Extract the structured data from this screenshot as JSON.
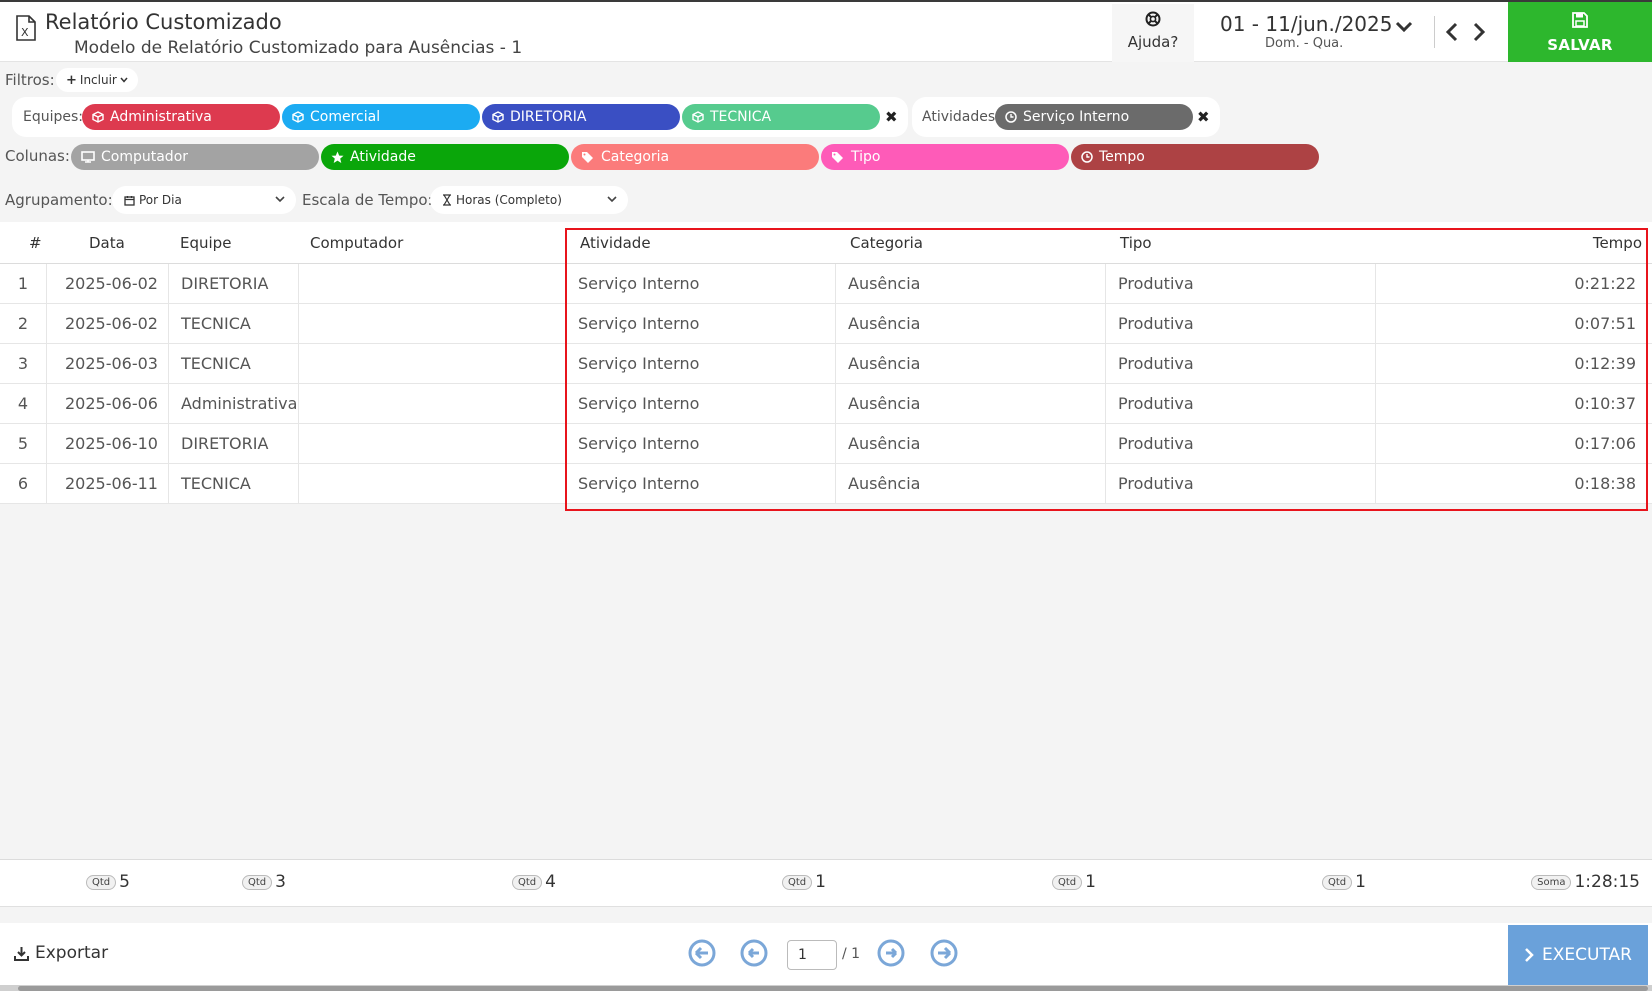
{
  "header": {
    "title": "Relatório Customizado",
    "subtitle": "Modelo de Relatório Customizado para Ausências - 1",
    "help_label": "Ajuda?",
    "date_range": "01 - 11/jun./2025",
    "date_days": "Dom. - Qua.",
    "save_label": "SALVAR"
  },
  "filters": {
    "label": "Filtros:",
    "include_label": "Incluir",
    "teams_label": "Equipes:",
    "teams": [
      {
        "label": "Administrativa",
        "color": "#dd3a4f"
      },
      {
        "label": "Comercial",
        "color": "#1cabf2"
      },
      {
        "label": "DIRETORIA",
        "color": "#3a4fc3"
      },
      {
        "label": "TECNICA",
        "color": "#56cb8e"
      }
    ],
    "activities_label": "Atividades:",
    "activities": [
      {
        "label": "Serviço Interno",
        "color": "#6b6b6b"
      }
    ]
  },
  "columns": {
    "label": "Colunas:",
    "items": [
      {
        "label": "Computador",
        "color": "#a3a3a3"
      },
      {
        "label": "Atividade",
        "color": "#0aa60a"
      },
      {
        "label": "Categoria",
        "color": "#fb7b7b"
      },
      {
        "label": "Tipo",
        "color": "#fe5bb8"
      },
      {
        "label": "Tempo",
        "color": "#ad4244"
      }
    ]
  },
  "grouping": {
    "label": "Agrupamento:",
    "value": "Por Dia",
    "scale_label": "Escala de Tempo:",
    "scale_value": "Horas (Completo)"
  },
  "table": {
    "headers": [
      "#",
      "Data",
      "Equipe",
      "Computador",
      "Atividade",
      "Categoria",
      "Tipo",
      "Tempo"
    ],
    "rows": [
      [
        "1",
        "2025-06-02",
        "DIRETORIA",
        "",
        "Serviço Interno",
        "Ausência",
        "Produtiva",
        "0:21:22"
      ],
      [
        "2",
        "2025-06-02",
        "TECNICA",
        "",
        "Serviço Interno",
        "Ausência",
        "Produtiva",
        "0:07:51"
      ],
      [
        "3",
        "2025-06-03",
        "TECNICA",
        "",
        "Serviço Interno",
        "Ausência",
        "Produtiva",
        "0:12:39"
      ],
      [
        "4",
        "2025-06-06",
        "Administrativa",
        "",
        "Serviço Interno",
        "Ausência",
        "Produtiva",
        "0:10:37"
      ],
      [
        "5",
        "2025-06-10",
        "DIRETORIA",
        "",
        "Serviço Interno",
        "Ausência",
        "Produtiva",
        "0:17:06"
      ],
      [
        "6",
        "2025-06-11",
        "TECNICA",
        "",
        "Serviço Interno",
        "Ausência",
        "Produtiva",
        "0:18:38"
      ]
    ]
  },
  "totals": [
    {
      "pill": "Qtd",
      "value": "5"
    },
    {
      "pill": "Qtd",
      "value": "3"
    },
    {
      "pill": "Qtd",
      "value": "4"
    },
    {
      "pill": "Qtd",
      "value": "1"
    },
    {
      "pill": "Qtd",
      "value": "1"
    },
    {
      "pill": "Qtd",
      "value": "1"
    },
    {
      "pill": "Soma",
      "value": "1:28:15"
    }
  ],
  "footer": {
    "export_label": "Exportar",
    "page_value": "1",
    "page_total": "/ 1",
    "execute_label": "EXECUTAR"
  }
}
